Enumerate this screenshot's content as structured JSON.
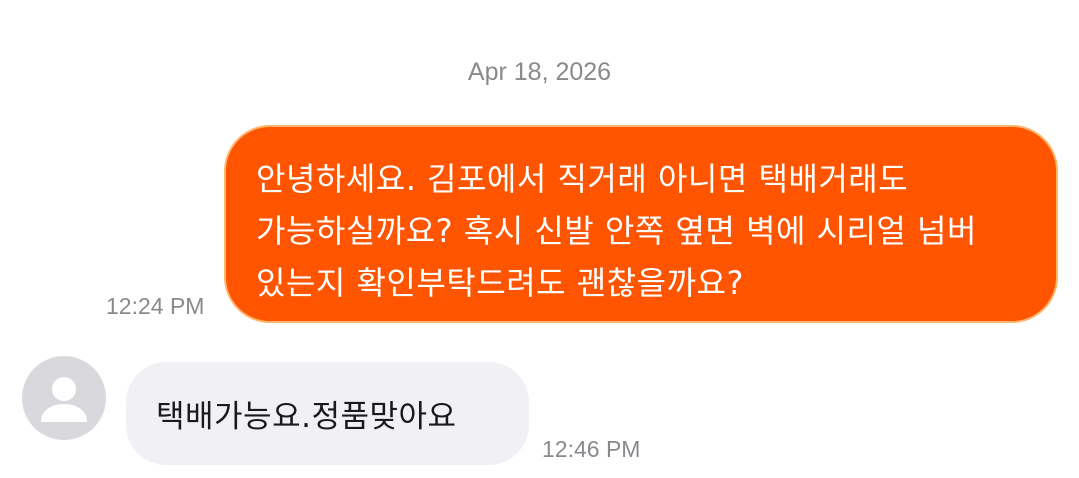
{
  "chat": {
    "date_separator": "Apr 18, 2026",
    "messages": [
      {
        "direction": "outgoing",
        "text": "안녕하세요. 김포에서 직거래 아니면 택배거래도 가능하실까요? 혹시 신발 안쪽 옆면 벽에 시리얼 넘버 있는지 확인부탁드려도 괜찮을까요?",
        "time": "12:24 PM"
      },
      {
        "direction": "incoming",
        "text": "택배가능요.정품맞아요",
        "time": "12:46 PM",
        "avatar_icon": "default-user-icon"
      }
    ]
  },
  "colors": {
    "outgoing_bubble": "#ff5500",
    "outgoing_border": "#ffb56a",
    "incoming_bubble": "#f1f1f5",
    "timestamp": "#8a8a8e",
    "avatar_bg": "#d9d9dd"
  }
}
